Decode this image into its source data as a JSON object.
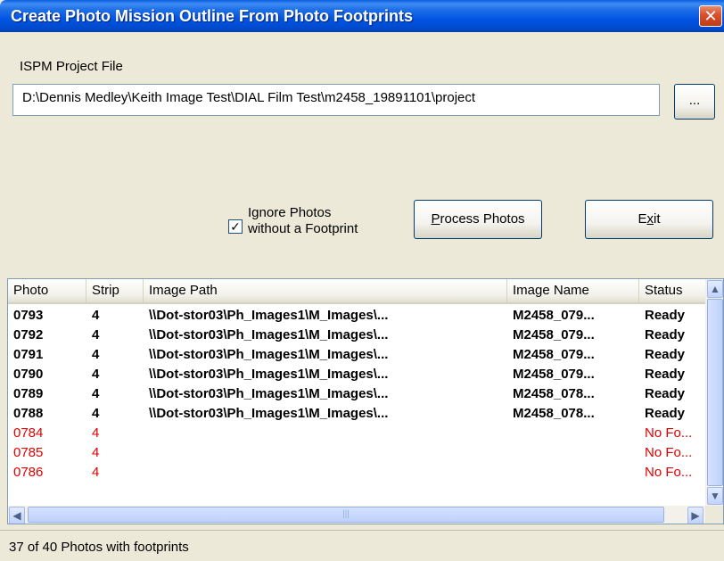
{
  "window": {
    "title": "Create Photo Mission Outline From Photo Footprints",
    "close": "✕"
  },
  "project": {
    "label": "ISPM Project File",
    "path": "D:\\Dennis Medley\\Keith Image Test\\DIAL Film Test\\m2458_19891101\\project",
    "browse_label": "..."
  },
  "options": {
    "ignore_checked": true,
    "ignore_line1": "Ignore Photos",
    "ignore_line2": "without  a Footprint"
  },
  "buttons": {
    "process": "Process Photos",
    "exit": "Exit"
  },
  "table": {
    "columns": [
      "Photo",
      "Strip",
      "Image Path",
      "Image Name",
      "Status"
    ],
    "rows": [
      {
        "photo": "0793",
        "strip": "4",
        "path": "\\\\Dot-stor03\\Ph_Images1\\M_Images\\...",
        "name": "M2458_079...",
        "status": "Ready",
        "state": "ready"
      },
      {
        "photo": "0792",
        "strip": "4",
        "path": "\\\\Dot-stor03\\Ph_Images1\\M_Images\\...",
        "name": "M2458_079...",
        "status": "Ready",
        "state": "ready"
      },
      {
        "photo": "0791",
        "strip": "4",
        "path": "\\\\Dot-stor03\\Ph_Images1\\M_Images\\...",
        "name": "M2458_079...",
        "status": "Ready",
        "state": "ready"
      },
      {
        "photo": "0790",
        "strip": "4",
        "path": "\\\\Dot-stor03\\Ph_Images1\\M_Images\\...",
        "name": "M2458_079...",
        "status": "Ready",
        "state": "ready"
      },
      {
        "photo": "0789",
        "strip": "4",
        "path": "\\\\Dot-stor03\\Ph_Images1\\M_Images\\...",
        "name": "M2458_078...",
        "status": "Ready",
        "state": "ready"
      },
      {
        "photo": "0788",
        "strip": "4",
        "path": "\\\\Dot-stor03\\Ph_Images1\\M_Images\\...",
        "name": "M2458_078...",
        "status": "Ready",
        "state": "ready"
      },
      {
        "photo": "0784",
        "strip": "4",
        "path": "",
        "name": "",
        "status": "No Fo...",
        "state": "nofoot"
      },
      {
        "photo": "0785",
        "strip": "4",
        "path": "",
        "name": "",
        "status": "No Fo...",
        "state": "nofoot"
      },
      {
        "photo": "0786",
        "strip": "4",
        "path": "",
        "name": "",
        "status": "No Fo...",
        "state": "nofoot"
      }
    ]
  },
  "status_bar": {
    "text": "37 of 40 Photos with footprints"
  },
  "colors": {
    "error_text": "#e00000",
    "title_bar": "#0054e3"
  }
}
